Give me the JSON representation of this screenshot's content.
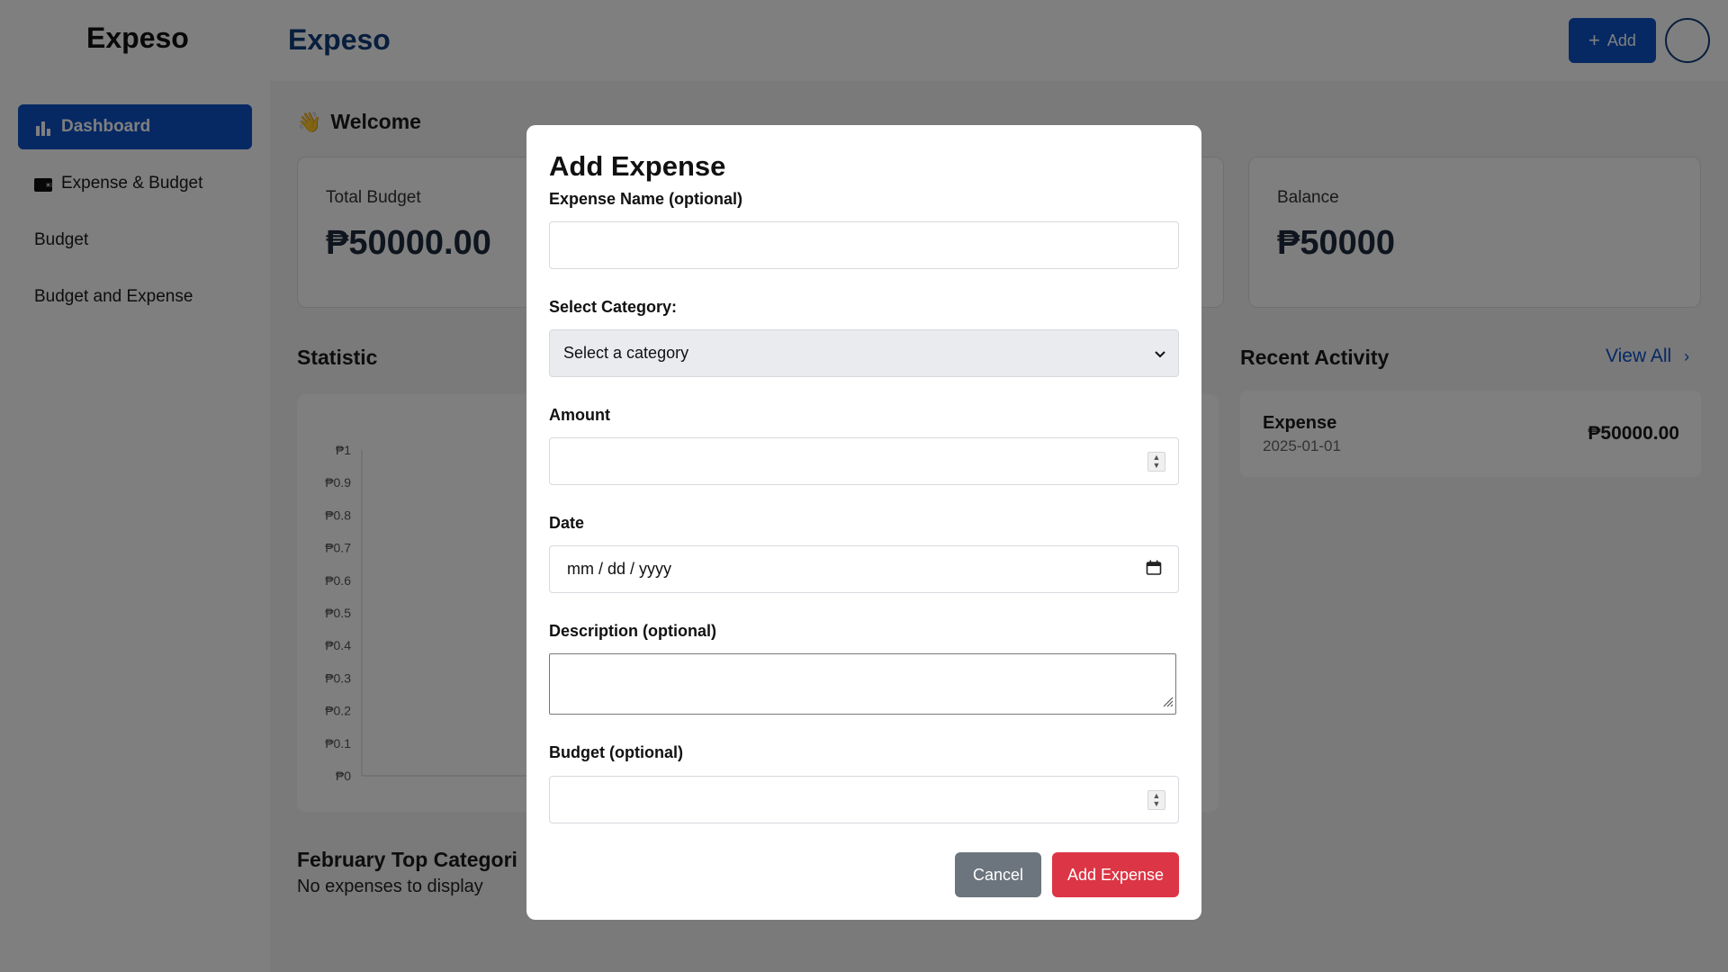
{
  "app": {
    "brand": "Expeso",
    "header_brand": "Expeso"
  },
  "header": {
    "add_label": "Add"
  },
  "sidebar": {
    "items": [
      {
        "label": "Dashboard",
        "icon": "bar-chart-icon",
        "active": true
      },
      {
        "label": "Expense & Budget",
        "icon": "wallet-icon",
        "active": false
      },
      {
        "label": "Budget",
        "icon": "",
        "active": false
      },
      {
        "label": "Budget and Expense",
        "icon": "",
        "active": false
      }
    ]
  },
  "main": {
    "welcome": "Welcome",
    "cards": [
      {
        "label": "Total Budget",
        "value": "₱50000.00"
      },
      {
        "label": "Balance",
        "value": "₱50000"
      }
    ],
    "statistic_title": "Statistic",
    "recent_activity": {
      "title": "Recent Activity",
      "view_all": "View All",
      "items": [
        {
          "title": "Expense",
          "date": "2025-01-01",
          "amount": "₱50000.00"
        }
      ]
    },
    "top_categories_title": "February Top Categori",
    "no_expenses": "No expenses to display"
  },
  "chart_data": {
    "type": "bar",
    "categories": [],
    "values": [],
    "ylim": [
      0,
      1
    ],
    "yticks": [
      "₱0",
      "₱0.1",
      "₱0.2",
      "₱0.3",
      "₱0.4",
      "₱0.5",
      "₱0.6",
      "₱0.7",
      "₱0.8",
      "₱0.9",
      "₱1"
    ]
  },
  "modal": {
    "title": "Add Expense",
    "fields": {
      "name_label": "Expense Name (optional)",
      "name_value": "",
      "category_label": "Select Category:",
      "category_selected": "Select a category",
      "amount_label": "Amount",
      "amount_value": "",
      "date_label": "Date",
      "date_placeholder": "mm / dd / yyyy",
      "description_label": "Description (optional)",
      "description_value": "",
      "budget_label": "Budget (optional)",
      "budget_value": ""
    },
    "cancel_label": "Cancel",
    "submit_label": "Add Expense"
  },
  "colors": {
    "primary": "#0d52c9",
    "danger": "#dc3545",
    "secondary": "#6c757d",
    "brand_dark": "#0f3d7a"
  }
}
